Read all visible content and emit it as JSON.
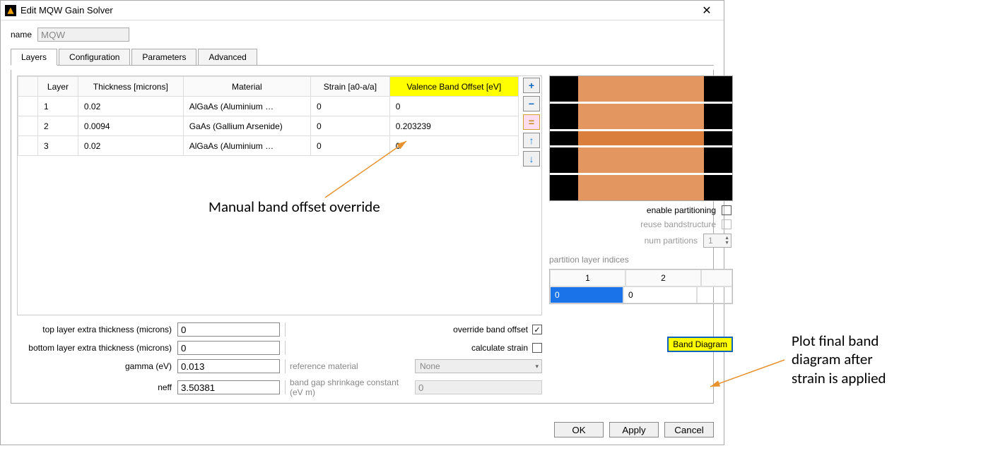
{
  "window": {
    "title": "Edit MQW Gain Solver"
  },
  "name_field": {
    "label": "name",
    "value": "MQW"
  },
  "tabs": [
    "Layers",
    "Configuration",
    "Parameters",
    "Advanced"
  ],
  "active_tab": 0,
  "table": {
    "headers": [
      "",
      "Layer",
      "Thickness [microns]",
      "Material",
      "Strain [a0-a/a]",
      "Valence Band Offset [eV]"
    ],
    "rows": [
      [
        "",
        "1",
        "0.02",
        "AlGaAs (Aluminium …",
        "0",
        "0"
      ],
      [
        "",
        "2",
        "0.0094",
        "GaAs (Gallium Arsenide)",
        "0",
        "0.203239"
      ],
      [
        "",
        "3",
        "0.02",
        "AlGaAs (Aluminium …",
        "0",
        "0"
      ]
    ]
  },
  "form": {
    "top_extra_label": "top layer extra thickness (microns)",
    "top_extra_value": "0",
    "bottom_extra_label": "bottom layer extra thickness (microns)",
    "bottom_extra_value": "0",
    "gamma_label": "gamma (eV)",
    "gamma_value": "0.013",
    "neff_label": "neff",
    "neff_value": "3.50381",
    "ref_material_label": "reference material",
    "ref_material_value": "None",
    "bgs_label": "band gap shrinkage constant (eV m)",
    "bgs_value": "0",
    "override_label": "override band offset",
    "override_checked": true,
    "calc_strain_label": "calculate strain",
    "calc_strain_checked": false
  },
  "right": {
    "enable_partitioning": {
      "label": "enable partitioning",
      "checked": false
    },
    "reuse_bandstructure": {
      "label": "reuse bandstructure",
      "checked": false,
      "disabled": true
    },
    "num_partitions": {
      "label": "num partitions",
      "value": "1",
      "disabled": true
    },
    "pli_label": "partition layer indices",
    "pli_headers": [
      "1",
      "2"
    ],
    "pli_values": [
      "0",
      "0"
    ],
    "band_diagram_label": "Band Diagram"
  },
  "buttons": {
    "ok": "OK",
    "apply": "Apply",
    "cancel": "Cancel"
  },
  "annotations": {
    "left_note": "Manual band offset override",
    "right_note_l1": "Plot final band",
    "right_note_l2": "diagram after",
    "right_note_l3": "strain is applied"
  }
}
